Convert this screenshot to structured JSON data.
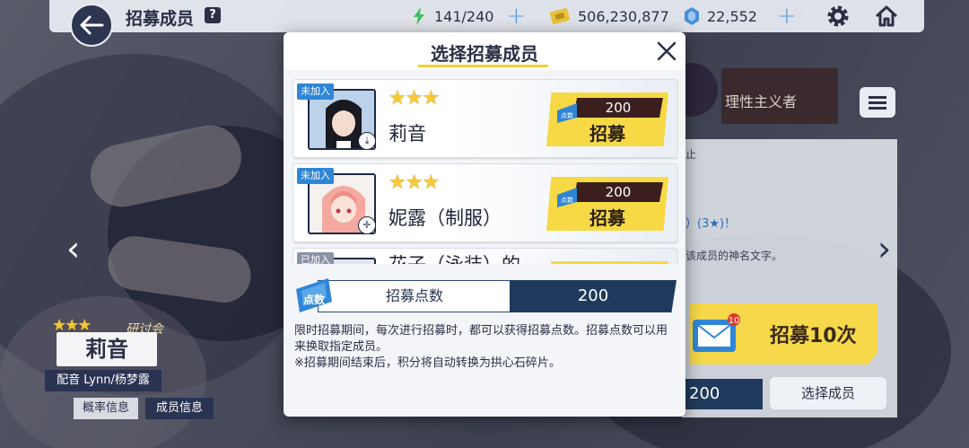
{
  "topbar": {
    "title": "招募成员",
    "help": "?",
    "energy": "141/240",
    "coins": "506,230,877",
    "gems": "22,552",
    "icons": [
      "back-arrow-icon",
      "lightning-icon",
      "coin-icon",
      "gem-icon",
      "gear-icon",
      "home-icon"
    ]
  },
  "character": {
    "tag": "研讨会",
    "name": "莉音",
    "cv": "配音 Lynn/杨梦露",
    "prob_button": "概率信息",
    "info_button": "成员信息"
  },
  "right_panel": {
    "line1": "止",
    "line2": "）(3★)！",
    "line3": "该成员的神名文字。",
    "banner_text": "理性主义者",
    "recruit10": "招募10次",
    "mail_badge": "10",
    "points": "200",
    "select_member": "选择成员"
  },
  "modal": {
    "title": "选择招募成员",
    "members": [
      {
        "badge": "未加入",
        "stars": "★★★",
        "name": "莉音",
        "cost": "200",
        "cost_label": "点数",
        "button": "招募"
      },
      {
        "badge": "未加入",
        "stars": "★★★",
        "name": "妮露（制服）",
        "cost": "200",
        "cost_label": "点数",
        "button": "招募"
      },
      {
        "badge": "已加入",
        "name": "花子（泳装）的"
      }
    ],
    "points_icon_label": "点数",
    "points_label": "招募点数",
    "points_value": "200",
    "description_1": "限时招募期间，每次进行招募时，都可以获得招募点数。招募点数可以用来换取指定成员。",
    "description_2": "※招募期间结束后，积分将自动转换为拱心石碎片。"
  },
  "colors": {
    "accent_yellow": "#f6d945",
    "navy": "#1f3a5c",
    "badge_blue": "#2f86d6"
  }
}
